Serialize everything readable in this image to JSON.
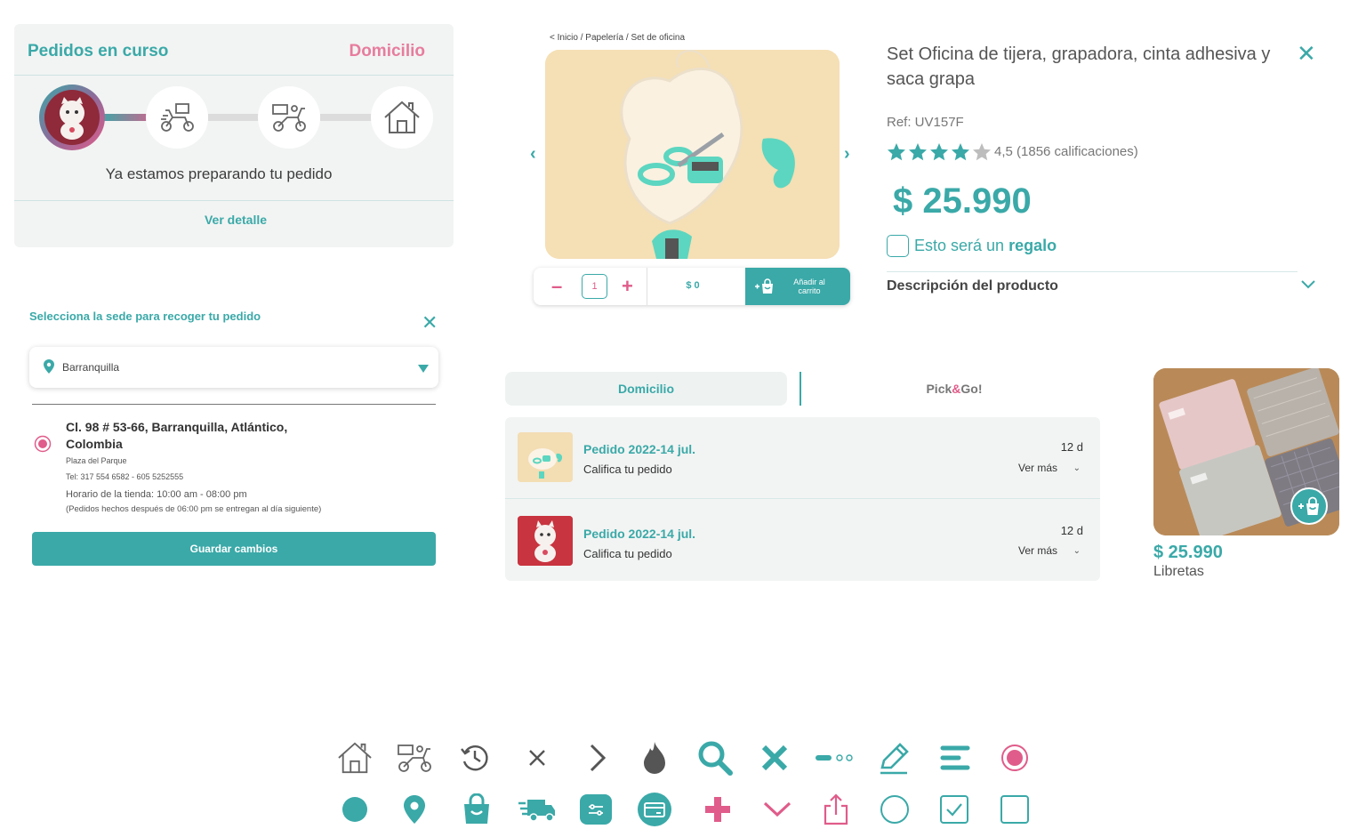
{
  "orders": {
    "title": "Pedidos en curso",
    "mode": "Domicilio",
    "status": "Ya estamos preparando tu pedido",
    "detail_link": "Ver detalle",
    "steps": [
      "product-avatar",
      "scooter-icon",
      "delivery-scooter-icon",
      "home-icon"
    ]
  },
  "pickup": {
    "title": "Selecciona la sede para recoger tu pedido",
    "city": "Barranquilla",
    "address": "Cl. 98 # 53-66, Barranquilla, Atlántico, Colombia",
    "store_name": "Plaza del Parque",
    "phone": "Tel: 317 554 6582 - 605 5252555",
    "hours": "Horario de la tienda: 10:00 am - 08:00 pm",
    "note": "(Pedidos hechos después de 06:00 pm se entregan al día siguiente)",
    "save_label": "Guardar cambios"
  },
  "product": {
    "breadcrumb": "< Inicio / Papelería / Set de oficina",
    "title": "Set Oficina de tijera, grapadora, cinta adhesiva y saca grapa",
    "ref": "Ref: UV157F",
    "rating": 4.5,
    "rating_text": "4,5 (1856 calificaciones)",
    "price": "$ 25.990",
    "gift_prefix": "Esto será un ",
    "gift_bold": "regalo",
    "description_title": "Descripción del producto",
    "quantity": "1",
    "total": "$ 0",
    "add_to_cart": "Añadir al carrito"
  },
  "delivery_tabs": {
    "tab_home": "Domicilio",
    "tab_pick_prefix": "Pick",
    "tab_pick_amp": "&",
    "tab_pick_suffix": "Go!"
  },
  "order_list": [
    {
      "title": "Pedido 2022-14 jul.",
      "subtitle": "Califica tu pedido",
      "days": "12 d",
      "more": "Ver más"
    },
    {
      "title": "Pedido 2022-14 jul.",
      "subtitle": "Califica tu pedido",
      "days": "12 d",
      "more": "Ver más"
    }
  ],
  "product_card": {
    "price": "$ 25.990",
    "name": "Libretas"
  },
  "colors": {
    "teal": "#3aa9a8",
    "pink": "#e05c8a",
    "light_bg": "#f2f4f3"
  },
  "icon_set": {
    "row1": [
      "home-icon",
      "delivery-scooter-icon",
      "history-icon",
      "close-thin-icon",
      "chevron-right-icon",
      "flame-icon",
      "search-icon",
      "close-bold-icon",
      "slider-dots-icon",
      "pencil-icon",
      "menu-lines-icon",
      "radio-selected-icon"
    ],
    "row2": [
      "circle-filled-icon",
      "location-pin-icon",
      "shopping-bag-icon",
      "delivery-truck-icon",
      "filter-card-icon",
      "card-payment-icon",
      "plus-icon",
      "chevron-down-icon",
      "share-icon",
      "radio-empty-icon",
      "checkbox-checked-icon",
      "checkbox-empty-icon"
    ]
  }
}
